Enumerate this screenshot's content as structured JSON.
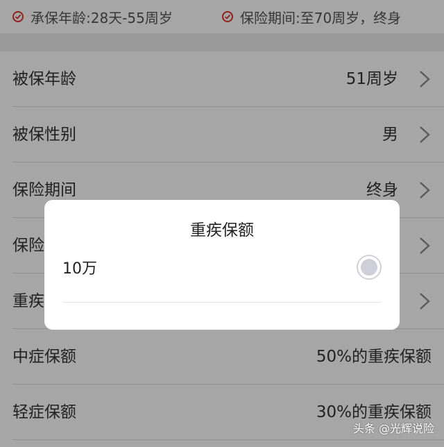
{
  "features": [
    {
      "text": "承保年龄:28天-55周岁"
    },
    {
      "text": "保险期间:至70周岁，终身"
    }
  ],
  "rows": [
    {
      "label": "被保年龄",
      "value": "51周岁",
      "chevron": true
    },
    {
      "label": "被保性别",
      "value": "男",
      "chevron": true
    },
    {
      "label": "保险期间",
      "value": "终身",
      "chevron": true
    },
    {
      "label": "保险",
      "value": "",
      "chevron": true
    },
    {
      "label": "重疾",
      "value": "",
      "chevron": true
    },
    {
      "label": "中症保额",
      "value": "50%的重疾保额",
      "chevron": false
    },
    {
      "label": "轻症保额",
      "value": "30%的重疾保额",
      "chevron": false
    }
  ],
  "dialog": {
    "title": "重疾保额",
    "options": [
      {
        "label": "10万",
        "selected": false
      }
    ]
  },
  "watermark": "头条 @光辉说险",
  "colors": {
    "accent": "#e0312c",
    "overlay": "rgba(0,0,0,0.35)"
  }
}
